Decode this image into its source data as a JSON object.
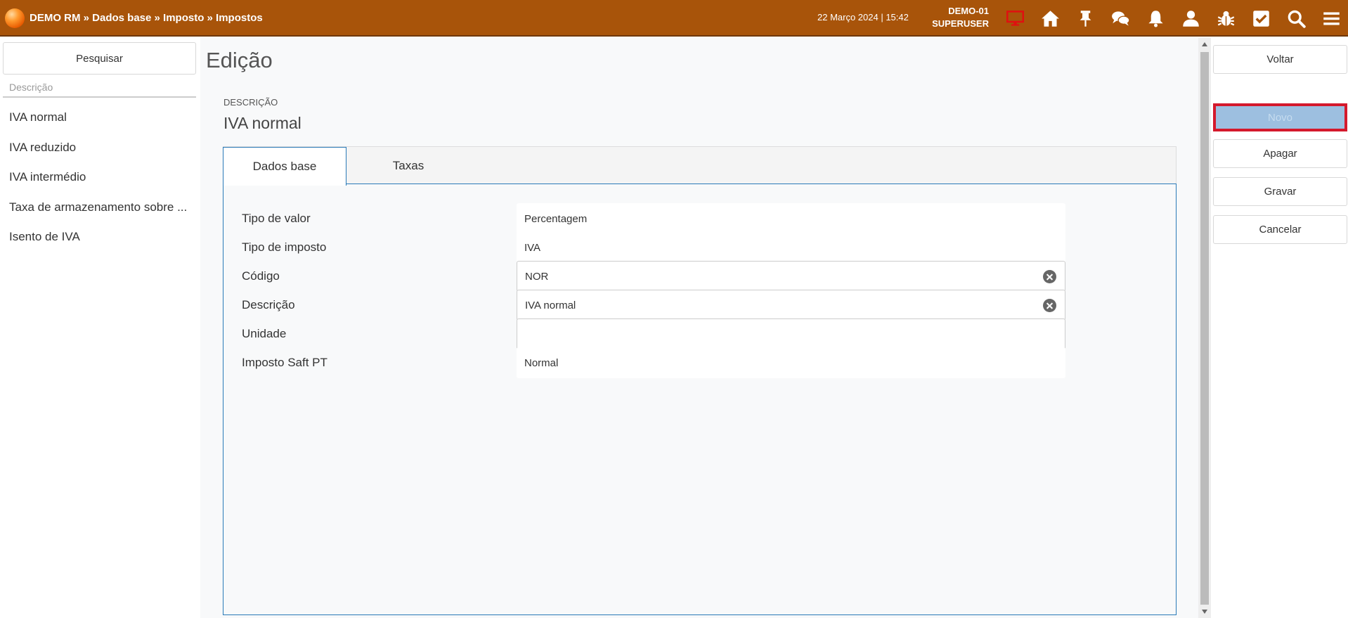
{
  "header": {
    "breadcrumb": "DEMO RM » Dados base » Imposto » Impostos",
    "datetime": "22 Março 2024 | 15:42",
    "company": "DEMO-01",
    "user": "SUPERUSER",
    "icons": [
      "monitor-icon",
      "home-icon",
      "pin-icon",
      "chat-icon",
      "bell-icon",
      "user-icon",
      "bug-icon",
      "checkbox-icon",
      "search-icon",
      "menu-icon"
    ],
    "accent_color": "#a8540a"
  },
  "sidebar": {
    "search_label": "Pesquisar",
    "column_header": "Descrição",
    "items": [
      {
        "label": "IVA normal"
      },
      {
        "label": "IVA reduzido"
      },
      {
        "label": "IVA intermédio"
      },
      {
        "label": "Taxa de armazenamento sobre ..."
      },
      {
        "label": "Isento de IVA"
      }
    ]
  },
  "main": {
    "title": "Edição",
    "description_label": "DESCRIÇÃO",
    "description_value": "IVA normal",
    "tabs": [
      {
        "label": "Dados base",
        "active": true
      },
      {
        "label": "Taxas",
        "active": false
      }
    ],
    "fields": {
      "tipo_valor": {
        "label": "Tipo de valor",
        "value": "Percentagem"
      },
      "tipo_imposto": {
        "label": "Tipo de imposto",
        "value": "IVA"
      },
      "codigo": {
        "label": "Código",
        "value": "NOR"
      },
      "descricao": {
        "label": "Descrição",
        "value": "IVA normal"
      },
      "unidade": {
        "label": "Unidade",
        "value": ""
      },
      "imposto_saft": {
        "label": "Imposto Saft PT",
        "value": "Normal"
      }
    }
  },
  "actions": {
    "voltar": "Voltar",
    "novo": "Novo",
    "apagar": "Apagar",
    "gravar": "Gravar",
    "cancelar": "Cancelar"
  }
}
